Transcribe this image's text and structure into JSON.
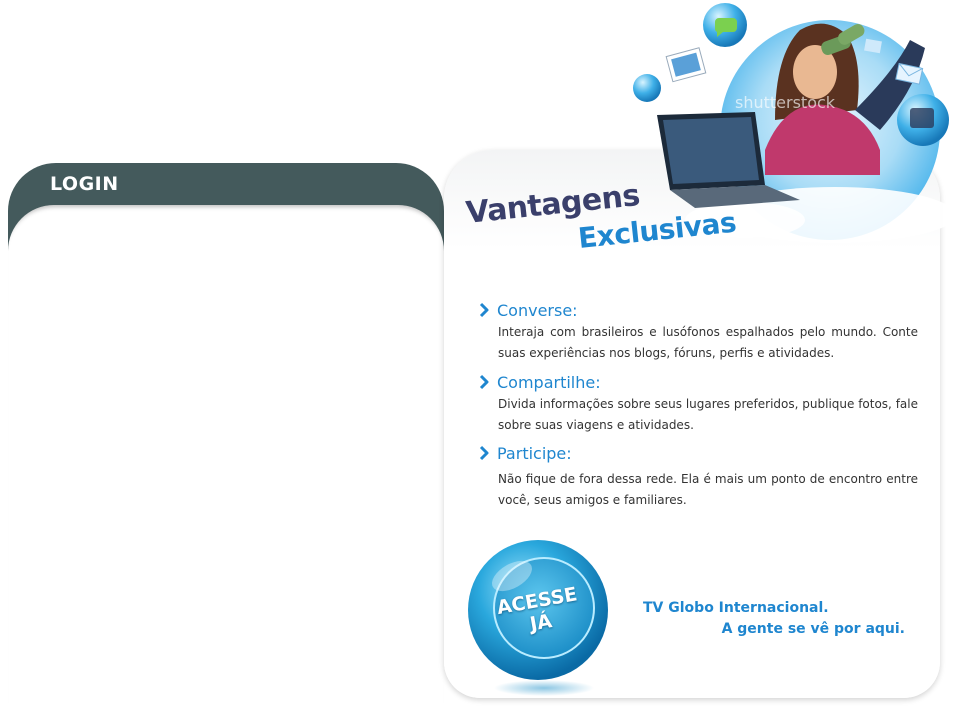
{
  "login": {
    "title": "LOGIN"
  },
  "hero": {
    "watermark": "shutterstock"
  },
  "heading": {
    "line1": "Vantagens",
    "line2": "Exclusivas"
  },
  "advantages": [
    {
      "title": "Converse:",
      "text": "Interaja com brasileiros e lusófonos espalhados pelo mundo. Conte suas experiências nos blogs, fóruns, perfis e atividades."
    },
    {
      "title": "Compartilhe:",
      "text": "Divida informações sobre seus lugares preferidos, publique fotos, fale sobre suas viagens e atividades."
    },
    {
      "title": "Participe:",
      "text": "Não fique de fora dessa rede. Ela é mais um ponto de encontro entre você, seus amigos e familiares."
    }
  ],
  "cta": {
    "line1": "ACESSE",
    "line2": "JÁ"
  },
  "tagline": {
    "line1": "TV Globo Internacional.",
    "line2": "A gente se vê por aqui."
  },
  "colors": {
    "header_dark": "#445a5c",
    "accent_blue": "#1f86cf",
    "heading_navy": "#3a3f6b"
  }
}
